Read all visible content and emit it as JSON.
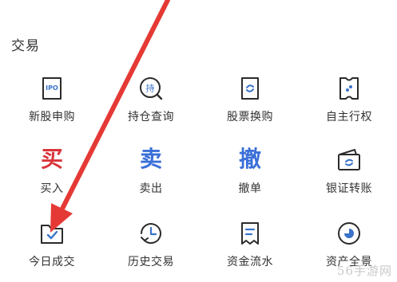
{
  "section": {
    "title": "交易"
  },
  "colors": {
    "buy": "#d9343a",
    "sell": "#3a6fd8",
    "cancel": "#3a6fd8",
    "icon_stroke": "#2b2b2b",
    "icon_accent": "#3a73c9",
    "arrow": "#e53935"
  },
  "items": [
    {
      "label": "新股申购",
      "icon": "ipo-doc-icon",
      "icon_text": "IPO"
    },
    {
      "label": "持仓查询",
      "icon": "holding-search-icon",
      "icon_text": "持"
    },
    {
      "label": "股票换购",
      "icon": "stock-exchange-doc-icon"
    },
    {
      "label": "自主行权",
      "icon": "ticket-exercise-icon"
    },
    {
      "label": "买入",
      "icon": "buy-char-icon",
      "icon_text": "买"
    },
    {
      "label": "卖出",
      "icon": "sell-char-icon",
      "icon_text": "卖"
    },
    {
      "label": "撤单",
      "icon": "cancel-char-icon",
      "icon_text": "撤"
    },
    {
      "label": "银证转账",
      "icon": "wallet-icon"
    },
    {
      "label": "今日成交",
      "icon": "folder-check-icon"
    },
    {
      "label": "历史交易",
      "icon": "history-clock-icon"
    },
    {
      "label": "资金流水",
      "icon": "flow-doc-icon"
    },
    {
      "label": "资产全景",
      "icon": "asset-pie-icon"
    }
  ],
  "watermark": "56手游网"
}
